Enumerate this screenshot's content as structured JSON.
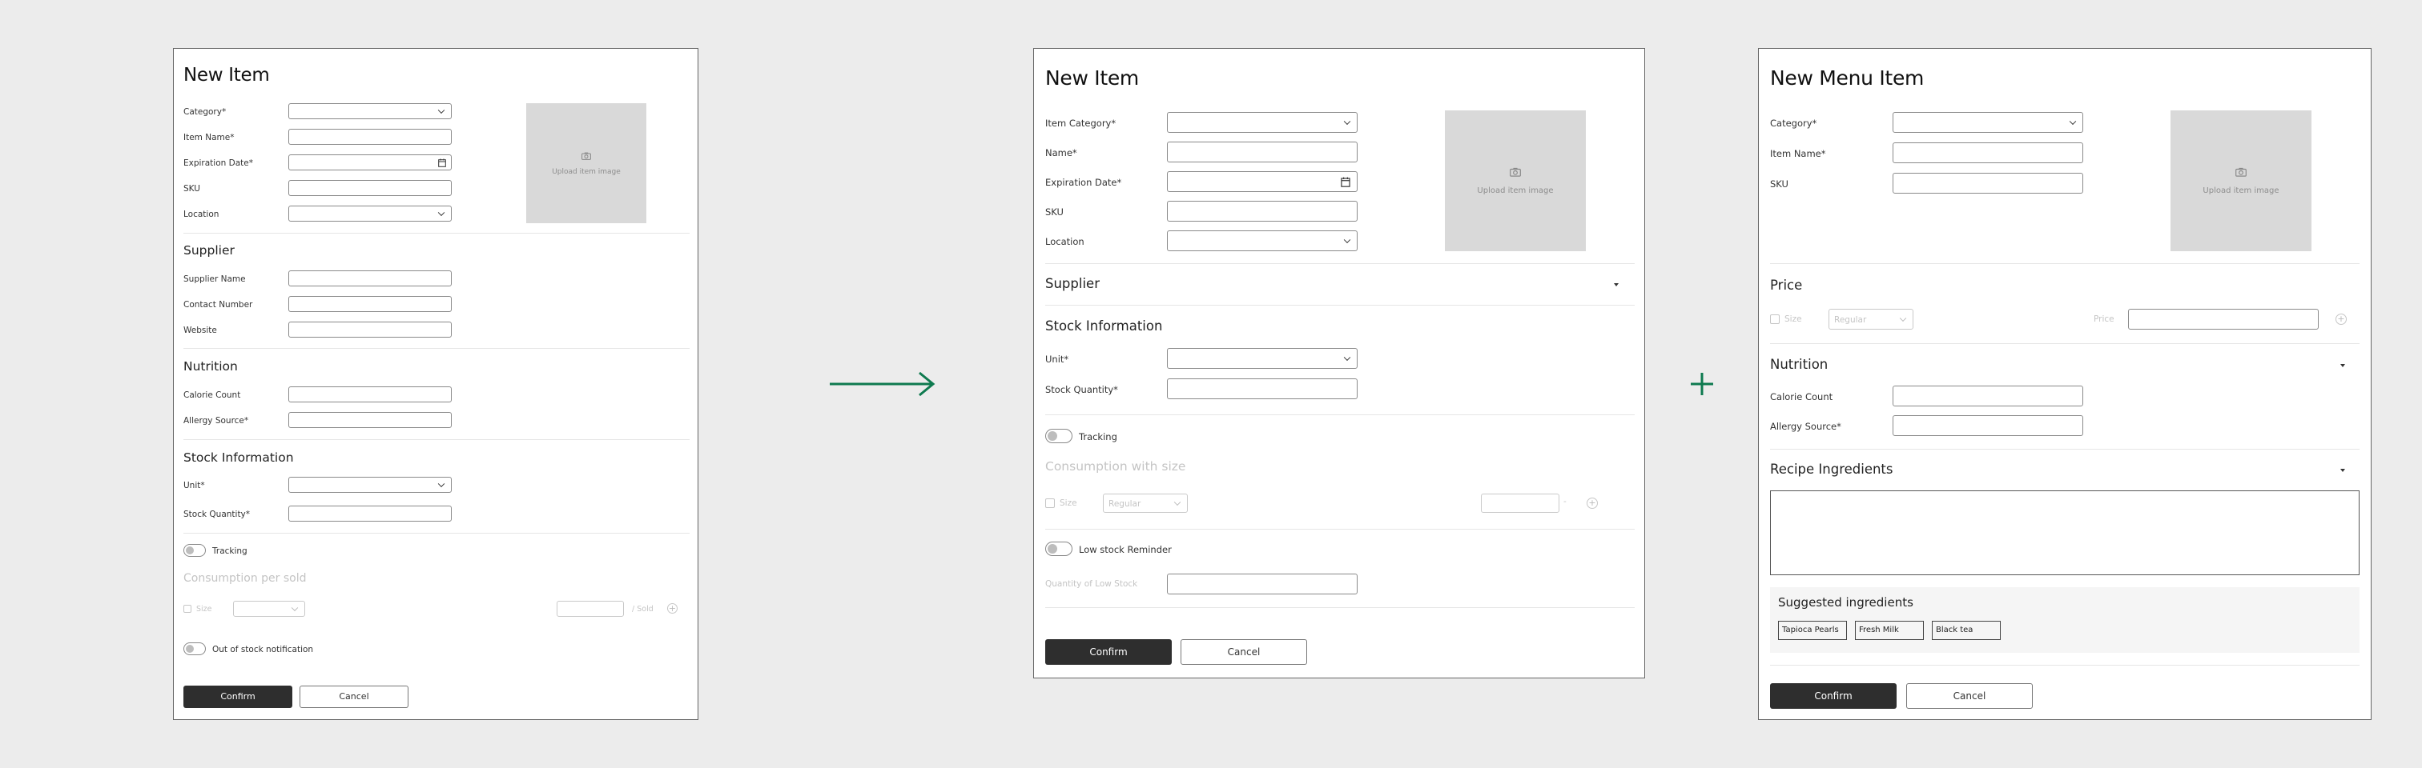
{
  "colors": {
    "background": "#ececec",
    "accent": "#0e7a4f",
    "dark_button": "#2e2e2e",
    "image_placeholder": "#d9d9d9"
  },
  "connectors": {
    "arrow_icon": "arrow-right-icon",
    "plus_icon": "plus-icon"
  },
  "panel1": {
    "title": "New Item",
    "fields": {
      "category": "Category*",
      "item_name": "Item Name*",
      "expiration_date": "Expiration Date*",
      "sku": "SKU",
      "location": "Location"
    },
    "image_label": "Upload item image",
    "supplier": {
      "heading": "Supplier",
      "name": "Supplier Name",
      "contact": "Contact Number",
      "website": "Website"
    },
    "nutrition": {
      "heading": "Nutrition",
      "calorie": "Calorie Count",
      "allergy": "Allergy Source*"
    },
    "stock": {
      "heading": "Stock Information",
      "unit": "Unit*",
      "quantity": "Stock Quantity*"
    },
    "tracking_label": "Tracking",
    "consumption": {
      "heading": "Consumption per sold",
      "size": "Size",
      "unit_suffix": "/ Sold"
    },
    "out_of_stock_label": "Out of stock notification",
    "confirm": "Confirm",
    "cancel": "Cancel"
  },
  "panel2": {
    "title": "New Item",
    "fields": {
      "category": "Item Category*",
      "name": "Name*",
      "expiration_date": "Expiration Date*",
      "sku": "SKU",
      "location": "Location"
    },
    "image_label": "Upload item image",
    "supplier_heading": "Supplier",
    "stock": {
      "heading": "Stock Information",
      "unit": "Unit*",
      "quantity": "Stock Quantity*"
    },
    "tracking_label": "Tracking",
    "consumption": {
      "heading": "Consumption with size",
      "size": "Size",
      "size_value": "Regular"
    },
    "low_stock_label": "Low stock Reminder",
    "low_stock_quantity": "Quantity of Low Stock",
    "confirm": "Confirm",
    "cancel": "Cancel"
  },
  "panel3": {
    "title": "New Menu Item",
    "fields": {
      "category": "Category*",
      "item_name": "Item Name*",
      "sku": "SKU"
    },
    "image_label": "Upload item image",
    "price": {
      "heading": "Price",
      "size": "Size",
      "size_value": "Regular",
      "price_label": "Price"
    },
    "nutrition": {
      "heading": "Nutrition",
      "calorie": "Calorie Count",
      "allergy": "Allergy Source*"
    },
    "recipe_heading": "Recipe Ingredients",
    "suggested": {
      "heading": "Suggested ingredients",
      "chips": [
        "Tapioca Pearls",
        "Fresh Milk",
        "Black tea"
      ]
    },
    "confirm": "Confirm",
    "cancel": "Cancel"
  }
}
